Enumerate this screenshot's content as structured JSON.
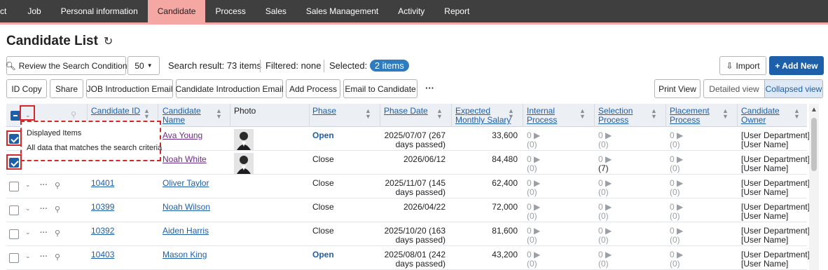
{
  "nav": [
    "ct",
    "Job",
    "Personal information",
    "Candidate",
    "Process",
    "Sales",
    "Sales Management",
    "Activity",
    "Report"
  ],
  "page": {
    "title": "Candidate List"
  },
  "toolbar": {
    "review_search": "Review the Search Condition",
    "page_size": "50",
    "search_result": "Search result: 73 items",
    "filtered": "Filtered: none",
    "selected_label": "Selected:",
    "selected_badge": "2 items",
    "import": "Import",
    "add_new": "+ Add New",
    "id_copy": "ID Copy",
    "share": "Share",
    "job_intro_email": "JOB Introduction Email",
    "candidate_intro_email": "Candidate Introduction Email",
    "add_process": "Add Process",
    "email_to_candidate": "Email to Candidate",
    "more": "···",
    "print_view": "Print View",
    "detailed_view": "Detailed view",
    "collapsed_view": "Collapsed view"
  },
  "columns": {
    "candidate_id": "Candidate ID",
    "candidate_name_1": "Candidate",
    "candidate_name_2": "Name",
    "photo": "Photo",
    "phase": "Phase",
    "phase_date": "Phase Date",
    "salary_1": "Expected",
    "salary_2": "Monthly Salary",
    "internal_1": "Internal",
    "internal_2": "Process",
    "selection_1": "Selection",
    "selection_2": "Process",
    "placement_1": "Placement",
    "placement_2": "Process",
    "owner_1": "Candidate",
    "owner_2": "Owner"
  },
  "dropdown": {
    "displayed_items": "Displayed Items",
    "all_data": "All data that matches the search criteria"
  },
  "rows": [
    {
      "id": "",
      "name": "Ava Young",
      "phase": "Open",
      "date_1": "2025/07/07 (267",
      "date_2": "days passed)",
      "salary": "33,600",
      "internal": "0 ▶",
      "internal_sub": "(0)",
      "selection": "0 ▶",
      "selection_sub": "(0)",
      "placement": "0 ▶",
      "placement_sub": "(0)",
      "owner_1": "[User Department]",
      "owner_2": "[User Name]"
    },
    {
      "id": "",
      "name": "Noah White",
      "phase": "Close",
      "date_1": "2026/06/12",
      "date_2": "",
      "salary": "84,480",
      "internal": "0 ▶",
      "internal_sub": "(0)",
      "selection": "0 ▶",
      "selection_sub": "(7)",
      "placement": "0 ▶",
      "placement_sub": "(0)",
      "owner_1": "[User Department]",
      "owner_2": "[User Name]"
    },
    {
      "id": "10401",
      "name": "Oliver Taylor",
      "phase": "Close",
      "date_1": "2025/11/07 (145",
      "date_2": "days passed)",
      "salary": "62,400",
      "internal": "0 ▶",
      "internal_sub": "(0)",
      "selection": "0 ▶",
      "selection_sub": "(0)",
      "placement": "0 ▶",
      "placement_sub": "(0)",
      "owner_1": "[User Department]",
      "owner_2": "[User Name]"
    },
    {
      "id": "10399",
      "name": "Noah Wilson",
      "phase": "Close",
      "date_1": "2026/04/22",
      "date_2": "",
      "salary": "72,000",
      "internal": "0 ▶",
      "internal_sub": "(0)",
      "selection": "0 ▶",
      "selection_sub": "(0)",
      "placement": "0 ▶",
      "placement_sub": "(0)",
      "owner_1": "[User Department]",
      "owner_2": "[User Name]"
    },
    {
      "id": "10392",
      "name": "Aiden Harris",
      "phase": "Close",
      "date_1": "2025/10/20 (163",
      "date_2": "days passed)",
      "salary": "81,600",
      "internal": "0 ▶",
      "internal_sub": "(0)",
      "selection": "0 ▶",
      "selection_sub": "(0)",
      "placement": "0 ▶",
      "placement_sub": "(0)",
      "owner_1": "[User Department]",
      "owner_2": "[User Name]"
    },
    {
      "id": "10403",
      "name": "Mason King",
      "phase": "Open",
      "date_1": "2025/08/01 (242",
      "date_2": "days passed)",
      "salary": "43,200",
      "internal": "0 ▶",
      "internal_sub": "(0)",
      "selection": "0 ▶",
      "selection_sub": "(0)",
      "placement": "0 ▶",
      "placement_sub": "(0)",
      "owner_1": "[User Department]",
      "owner_2": "[User Name]"
    }
  ]
}
